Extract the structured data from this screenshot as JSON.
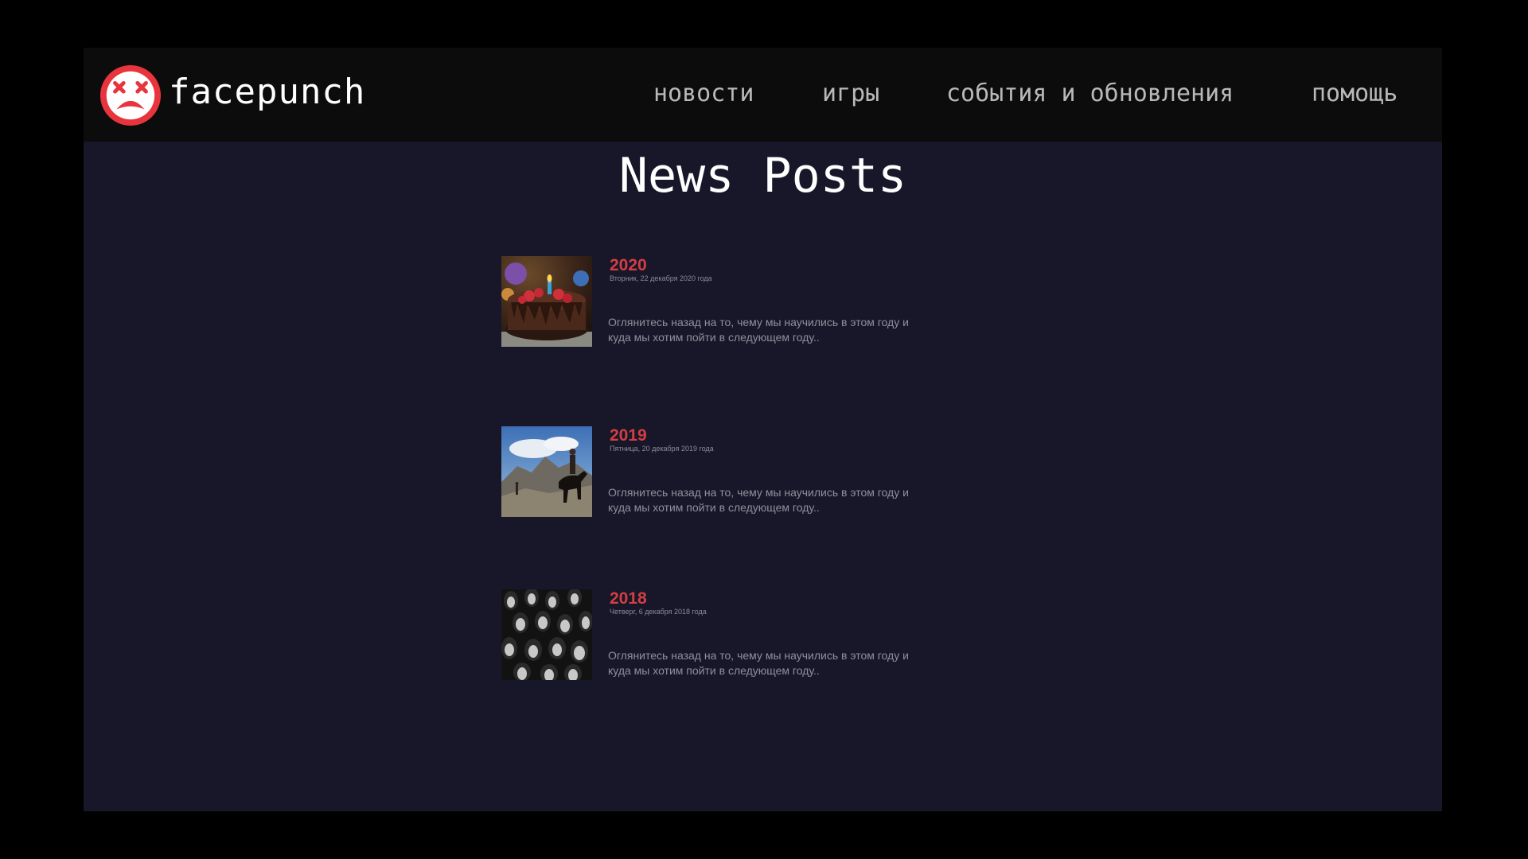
{
  "header": {
    "brand": "facepunch",
    "nav": [
      "новости",
      "игры",
      "события и обновления",
      "помощь"
    ]
  },
  "main": {
    "title": "News Posts",
    "posts": [
      {
        "year": "2020",
        "date": "Вторник, 22 декабря 2020 года",
        "excerpt": "Оглянитесь назад на то, чему мы научились в этом году и куда мы хотим пойти в следующем году..",
        "image": "birthday-cake"
      },
      {
        "year": "2019",
        "date": "Пятница, 20 декабря 2019 года",
        "excerpt": "Оглянитесь назад на то, чему мы научились в этом году и куда мы хотим пойти в следующем году..",
        "image": "horse-rider"
      },
      {
        "year": "2018",
        "date": "Четверг, 6 декабря 2018 года",
        "excerpt": "Оглянитесь назад на то, чему мы научились в этом году и куда мы хотим пойти в следующем году..",
        "image": "masked-crowd"
      }
    ]
  },
  "colors": {
    "accent": "#d23f43",
    "background": "#18172a",
    "header": "#0c0c0d"
  }
}
